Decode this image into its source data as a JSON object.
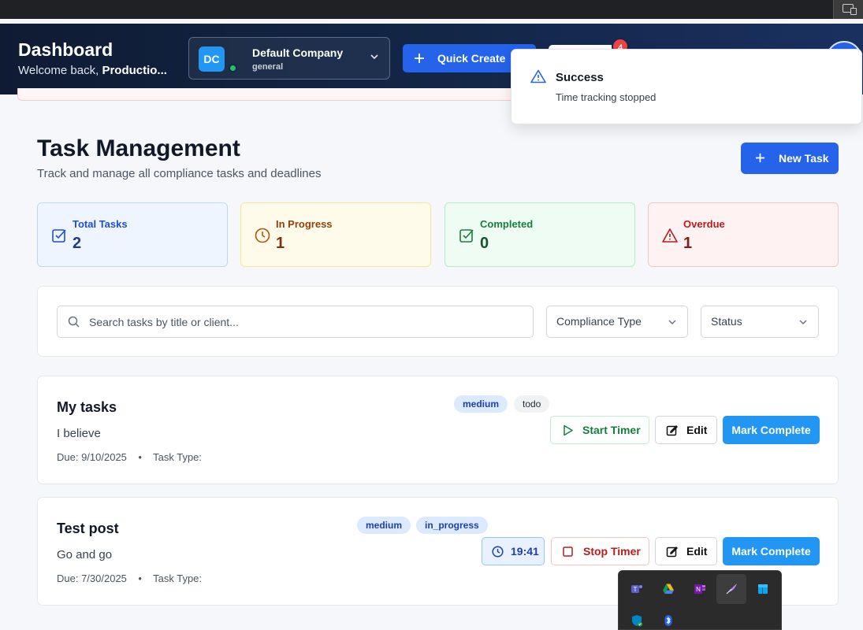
{
  "header": {
    "title": "Dashboard",
    "welcome_prefix": "Welcome back, ",
    "welcome_user": "Productio...",
    "company": {
      "initials": "DC",
      "name": "Default Company",
      "subtitle": "general"
    },
    "quick_create_label": "Quick Create",
    "notification_count": "4"
  },
  "toast": {
    "title": "Success",
    "message": "Time tracking stopped"
  },
  "page": {
    "title": "Task Management",
    "subtitle": "Track and manage all compliance tasks and deadlines",
    "new_task_label": "New Task"
  },
  "stats": [
    {
      "label": "Total Tasks",
      "value": "2",
      "color": "#1d4ed8"
    },
    {
      "label": "In Progress",
      "value": "1",
      "color": "#b45309"
    },
    {
      "label": "Completed",
      "value": "0",
      "color": "#15803d"
    },
    {
      "label": "Overdue",
      "value": "1",
      "color": "#b91c1c"
    }
  ],
  "filters": {
    "search_placeholder": "Search tasks by title or client...",
    "compliance_type": "Compliance Type",
    "status": "Status"
  },
  "tasks": [
    {
      "title": "My tasks",
      "description": "I believe",
      "meta": "Due: 9/10/2025    •    Task Type:",
      "priority": "medium",
      "status": "todo",
      "timer_label": "Start Timer",
      "edit_label": "Edit",
      "complete_label": "Mark Complete"
    },
    {
      "title": "Test post",
      "description": "Go and go",
      "meta": "Due: 7/30/2025    •    Task Type:",
      "priority": "medium",
      "status": "in_progress",
      "elapsed": "19:41",
      "timer_label": "Stop Timer",
      "edit_label": "Edit",
      "complete_label": "Mark Complete"
    }
  ],
  "tray_icons": [
    "teams-icon",
    "google-drive-icon",
    "onenote-icon",
    "quill-icon",
    "azure-icon",
    "defender-icon",
    "bluetooth-icon"
  ]
}
